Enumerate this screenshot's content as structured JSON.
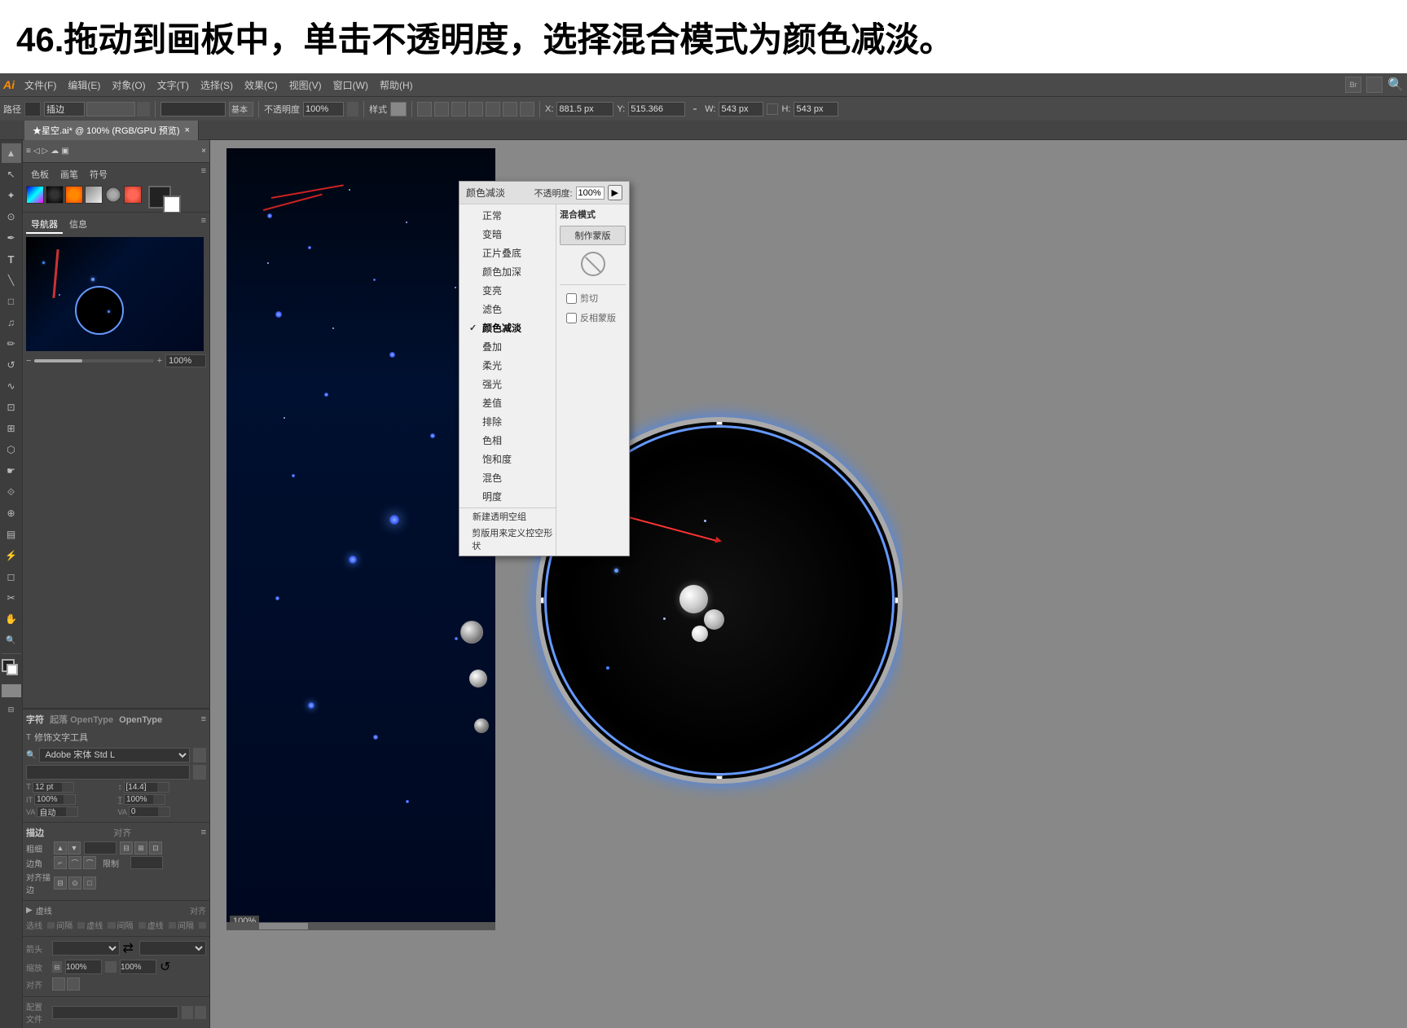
{
  "title": {
    "text": "46.拖动到画板中，单击不透明度，选择混合模式为颜色减淡。"
  },
  "menubar": {
    "logo": "Ai",
    "items": [
      {
        "label": "文件(F)"
      },
      {
        "label": "编辑(E)"
      },
      {
        "label": "对象(O)"
      },
      {
        "label": "文字(T)"
      },
      {
        "label": "选择(S)"
      },
      {
        "label": "效果(C)"
      },
      {
        "label": "视图(V)"
      },
      {
        "label": "窗口(W)"
      },
      {
        "label": "帮助(H)"
      }
    ]
  },
  "toolbar": {
    "path_label": "路径",
    "mode_label": "插边",
    "opacity_label": "不透明度",
    "opacity_value": "100%",
    "style_label": "样式",
    "x_label": "X:",
    "x_value": "881.5 px",
    "y_label": "Y:",
    "y_value": "515.366",
    "w_label": "W:",
    "w_value": "543 px",
    "h_label": "H:",
    "h_value": "543 px"
  },
  "tabs": [
    {
      "label": "★星空.ai* @ 100% (RGB/GPU 预览)",
      "active": true
    }
  ],
  "blend_dropdown": {
    "title": "颜色减淡",
    "opacity_label": "不透明度:",
    "opacity_value": "100%",
    "blend_mode_label": "混合模式",
    "make_mask_label": "制作蒙版",
    "cut_label": "剪切",
    "invert_label": "反相蒙版",
    "modes": [
      {
        "label": "正常",
        "selected": false
      },
      {
        "label": "变暗",
        "selected": false
      },
      {
        "label": "正片叠底",
        "selected": false
      },
      {
        "label": "颜色加深",
        "selected": false
      },
      {
        "label": "变亮",
        "selected": false
      },
      {
        "label": "滤色",
        "selected": false
      },
      {
        "label": "颜色减淡",
        "selected": true
      },
      {
        "label": "叠加",
        "selected": false
      },
      {
        "label": "柔光",
        "selected": false
      },
      {
        "label": "强光",
        "selected": false
      },
      {
        "label": "差值",
        "selected": false
      },
      {
        "label": "排除",
        "selected": false
      },
      {
        "label": "色相",
        "selected": false
      },
      {
        "label": "饱和度",
        "selected": false
      },
      {
        "label": "混色",
        "selected": false
      },
      {
        "label": "明度",
        "selected": false
      }
    ],
    "extra_options": [
      {
        "label": "新建透明空组"
      },
      {
        "label": "剪版用来定义控空形状"
      }
    ]
  },
  "left_panel": {
    "tabs": [
      "色板",
      "画笔",
      "符号"
    ],
    "nav_tabs": [
      "导航器",
      "信息"
    ],
    "zoom_value": "100%",
    "char_panel_title": "字符",
    "char_subtitle": "起落  OpenType",
    "font_tool_label": "修饰文字工具",
    "font_family": "Adobe 宋体 Std L",
    "font_size": "12 pt",
    "leading": "[14.4]",
    "scale_h": "100%",
    "scale_v": "100%",
    "track": "自动",
    "kern": "0"
  },
  "stroke_panel": {
    "title": "描边",
    "align_label": "对齐",
    "weight_label": "粗细",
    "corner_label": "边角",
    "align_stroke_label": "对齐描边",
    "limit_label": "限制",
    "dashed_label": "虚线",
    "dash_labels": [
      "选线",
      "间隔",
      "虚线",
      "间隔",
      "虚线",
      "间隔"
    ],
    "arrow_start_label": "箭头",
    "scale_label": "缩放",
    "pct_100": "100%",
    "align_label2": "对齐",
    "profile_label": "配置文件"
  },
  "icons": {
    "selection": "▲",
    "direct": "↖",
    "pen": "✒",
    "type": "T",
    "shape": "□",
    "brush": "ʃ",
    "rotate": "↺",
    "scale": "⊡",
    "warp": "∿",
    "eyedrop": "☛",
    "gradient": "■",
    "mesh": "⊞",
    "blend": "⟐",
    "symbol": "⊕",
    "column": "▤",
    "slice": "⚡",
    "hand": "✋",
    "zoom": "🔍",
    "fill": "■",
    "stroke": "□"
  }
}
